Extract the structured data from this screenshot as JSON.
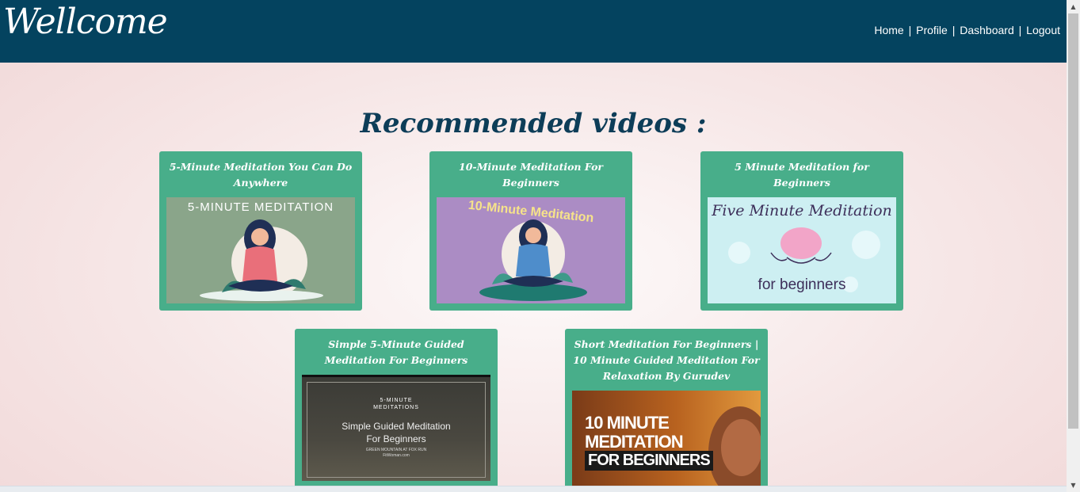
{
  "header": {
    "logo": "Wellcome",
    "nav": {
      "home": "Home",
      "profile": "Profile",
      "dashboard": "Dashboard",
      "logout": "Logout",
      "separator": "|"
    }
  },
  "section_title": "Recommended videos :",
  "videos": [
    {
      "title": "5-Minute Meditation You Can Do Anywhere",
      "thumb_text": "5-MINUTE MEDITATION"
    },
    {
      "title": "10-Minute Meditation For Beginners",
      "thumb_text": "10-Minute Meditation"
    },
    {
      "title": "5 Minute Meditation for Beginners",
      "thumb_text": "Five Minute Meditation",
      "thumb_subtext": "for beginners"
    },
    {
      "title": "Simple 5-Minute Guided Meditation For Beginners",
      "thumb_kicker": "5-MINUTE",
      "thumb_kicker2": "MEDITATIONS",
      "thumb_text": "Simple Guided Meditation",
      "thumb_text2": "For Beginners",
      "thumb_small": "GREEN MOUNTAIN AT FOX RUN",
      "thumb_small2": "FitWoman.com"
    },
    {
      "title": "Short Meditation For Beginners | 10 Minute Guided Meditation For Relaxation By Gurudev",
      "thumb_text": "10 MINUTE",
      "thumb_text2": "MEDITATION",
      "thumb_text3": "FOR BEGINNERS"
    }
  ],
  "colors": {
    "header": "#04435f",
    "card": "#48ae8a",
    "title": "#0d3d58"
  }
}
